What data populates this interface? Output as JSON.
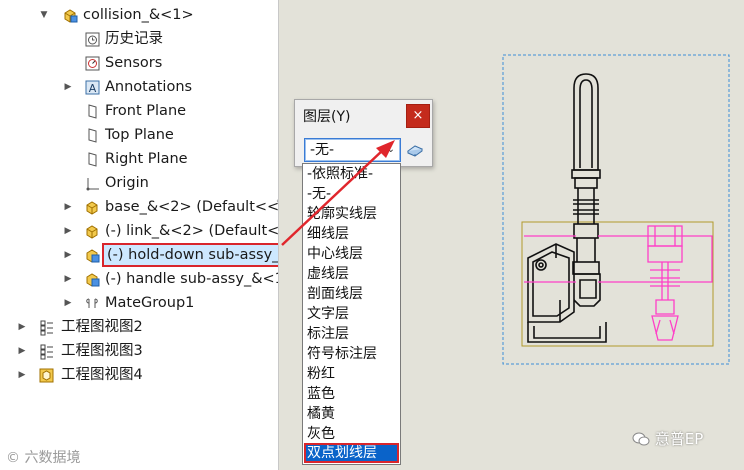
{
  "tree": {
    "items": [
      {
        "label": "collision_&<1>",
        "icon": "assembly-icon"
      },
      {
        "label": "历史记录",
        "icon": "history-icon"
      },
      {
        "label": "Sensors",
        "icon": "sensors-icon"
      },
      {
        "label": "Annotations",
        "icon": "annotations-icon"
      },
      {
        "label": "Front Plane",
        "icon": "plane-icon"
      },
      {
        "label": "Top Plane",
        "icon": "plane-icon"
      },
      {
        "label": "Right Plane",
        "icon": "plane-icon"
      },
      {
        "label": "Origin",
        "icon": "origin-icon"
      },
      {
        "label": "base_&<2> (Default<<",
        "icon": "part-icon"
      },
      {
        "label": "(-) link_&<2> (Default<",
        "icon": "part-icon"
      },
      {
        "label": "(-) hold-down sub-assy_",
        "icon": "subassembly-icon"
      },
      {
        "label": "(-) handle sub-assy_&<1",
        "icon": "subassembly-icon"
      },
      {
        "label": "MateGroup1",
        "icon": "mategroup-icon"
      },
      {
        "label": "工程图视图2",
        "icon": "drawing-view-icon"
      },
      {
        "label": "工程图视图3",
        "icon": "drawing-view-icon"
      },
      {
        "label": "工程图视图4",
        "icon": "drawing-view-icon"
      }
    ]
  },
  "dialog": {
    "title": "图层(Y)",
    "close_label": "×",
    "selected": "-无-"
  },
  "dropdown": {
    "options": [
      "-依照标准-",
      "-无-",
      "轮廓实线层",
      "细线层",
      "中心线层",
      "虚线层",
      "剖面线层",
      "文字层",
      "标注层",
      "符号标注层",
      "粉红",
      "蓝色",
      "橘黄",
      "灰色",
      "双点划线层"
    ],
    "highlighted_index": 14
  },
  "watermarks": {
    "left": "© 六数据境",
    "right": "意普EP"
  },
  "colors": {
    "highlight_border": "#d9262c",
    "selection_blue": "#0a63c9",
    "canvas_bg": "#e3e2d9",
    "drawing_pink": "#ff3fc8"
  }
}
